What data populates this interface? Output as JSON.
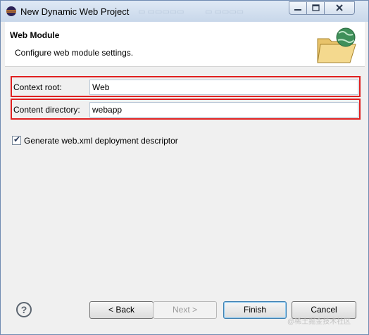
{
  "window": {
    "title": "New Dynamic Web Project"
  },
  "banner": {
    "heading": "Web Module",
    "description": "Configure web module settings."
  },
  "fields": {
    "context_root": {
      "label": "Context root:",
      "value": "Web"
    },
    "content_directory": {
      "label": "Content directory:",
      "value": "webapp"
    }
  },
  "checkbox": {
    "label": "Generate web.xml deployment descriptor",
    "checked": true
  },
  "buttons": {
    "back": "< Back",
    "next": "Next >",
    "finish": "Finish",
    "cancel": "Cancel"
  },
  "watermark": "@稀土掘金技术社区",
  "colors": {
    "highlight_border": "#e02020",
    "finish_accent": "#3c7fb1"
  }
}
